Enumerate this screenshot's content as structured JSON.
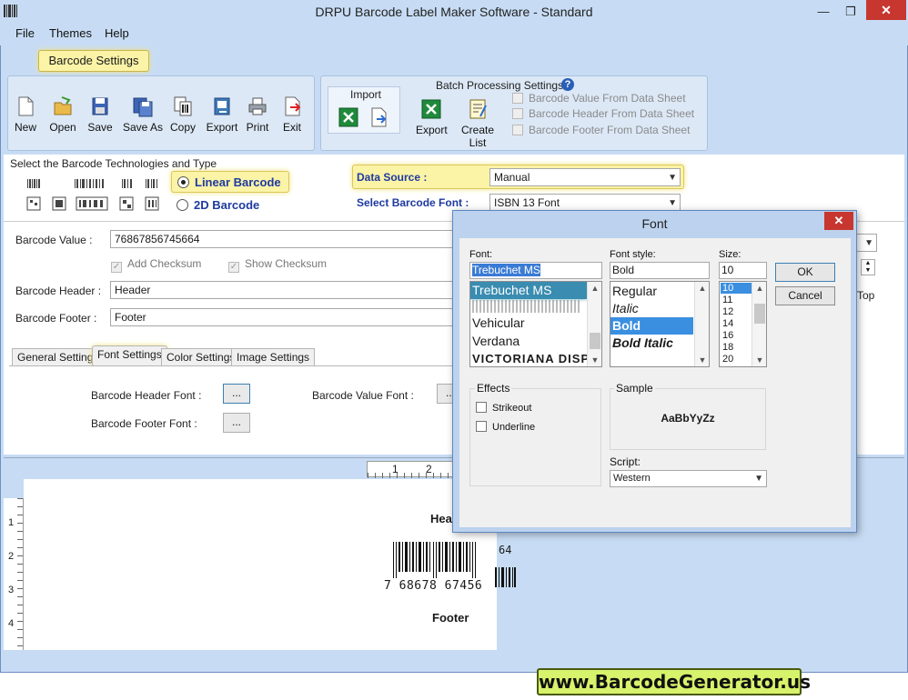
{
  "window": {
    "title": "DRPU Barcode Label Maker Software - Standard"
  },
  "menu": [
    "File",
    "Themes",
    "Help"
  ],
  "ribbon": {
    "tab": "Barcode Settings",
    "buttons": [
      "New",
      "Open",
      "Save",
      "Save As",
      "Copy",
      "Export",
      "Print",
      "Exit"
    ],
    "import": {
      "title": "Import"
    },
    "batch": {
      "title": "Batch Processing Settings",
      "export": "Export",
      "create_list": "Create List",
      "options": [
        "Barcode Value From Data Sheet",
        "Barcode Header From Data Sheet",
        "Barcode Footer From Data Sheet"
      ]
    }
  },
  "technology": {
    "label": "Select the Barcode Technologies and Type",
    "linear": "Linear Barcode",
    "twod": "2D Barcode",
    "data_source_label": "Data Source :",
    "data_source_value": "Manual",
    "font_label": "Select Barcode Font :",
    "font_value": "ISBN 13 Font"
  },
  "form": {
    "value_label": "Barcode Value :",
    "value": "76867856745664",
    "add_checksum": "Add Checksum",
    "show_checksum": "Show Checksum",
    "header_label": "Barcode Header :",
    "header": "Header",
    "footer_label": "Barcode Footer :",
    "footer": "Footer",
    "top_label": "Top"
  },
  "tabs": [
    "General Settings",
    "Font Settings",
    "Color Settings",
    "Image Settings"
  ],
  "font_settings": {
    "header_font": "Barcode Header Font :",
    "footer_font": "Barcode Footer Font :",
    "value_font": "Barcode Value Font :",
    "browse": "..."
  },
  "preview": {
    "hruler": [
      "1",
      "2"
    ],
    "vruler": [
      "1",
      "2",
      "3",
      "4"
    ],
    "header": "Hea",
    "digits": "7 68678 67456",
    "addon": "64",
    "footer": "Footer"
  },
  "font_dialog": {
    "title": "Font",
    "font_label": "Font:",
    "font_value": "Trebuchet MS",
    "fonts": [
      "Trebuchet MS",
      "Vehicular",
      "Verdana",
      "VICTORIANA DISP"
    ],
    "style_label": "Font style:",
    "style_value": "Bold",
    "styles": [
      "Regular",
      "Italic",
      "Bold",
      "Bold Italic"
    ],
    "size_label": "Size:",
    "size_value": "10",
    "sizes": [
      "10",
      "11",
      "12",
      "14",
      "16",
      "18",
      "20"
    ],
    "ok": "OK",
    "cancel": "Cancel",
    "effects_label": "Effects",
    "strikeout": "Strikeout",
    "underline": "Underline",
    "sample_label": "Sample",
    "sample_text": "AaBbYyZz",
    "script_label": "Script:",
    "script_value": "Western"
  },
  "brand": "www.BarcodeGenerator.us"
}
